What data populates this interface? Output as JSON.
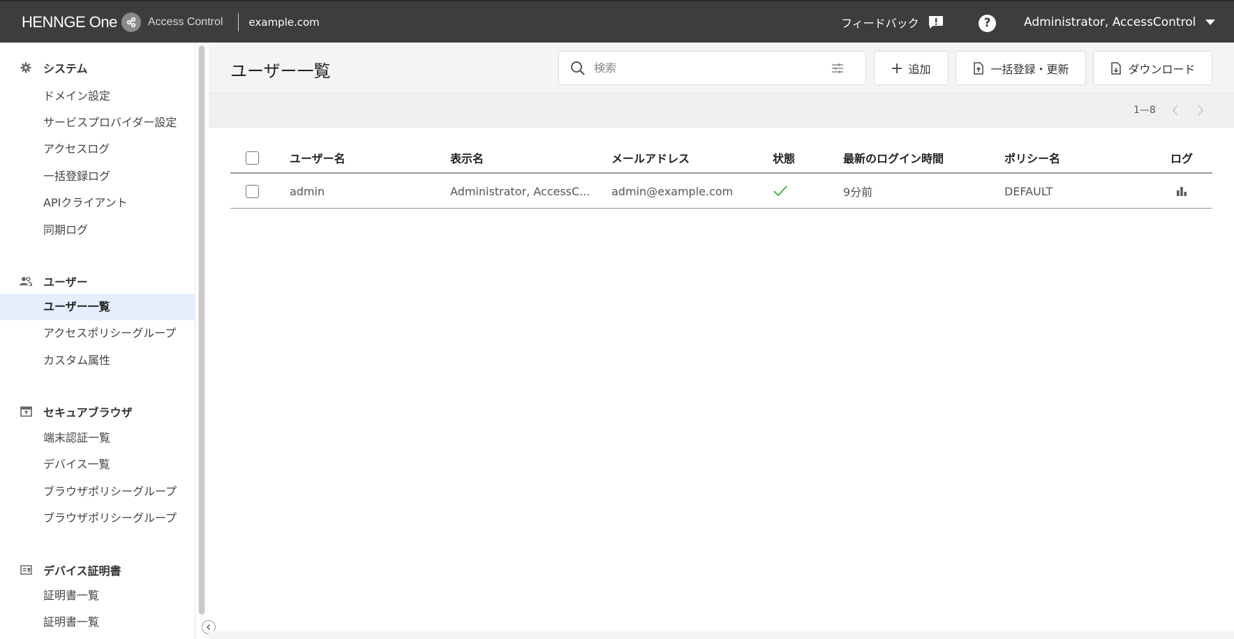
{
  "topbar": {
    "brand_name": "HENNGE One",
    "product_name": "Access Control",
    "domain": "example.com",
    "feedback_label": "フィードバック",
    "help_label": "?",
    "user_name": "Administrator, AccessControl"
  },
  "sidebar": {
    "sections": [
      {
        "title": "システム",
        "icon": "gear-icon",
        "items": [
          "ドメイン設定",
          "サービスプロバイダー設定",
          "アクセスログ",
          "一括登録ログ",
          "APIクライアント",
          "同期ログ"
        ]
      },
      {
        "title": "ユーザー",
        "icon": "users-icon",
        "items": [
          "ユーザー一覧",
          "アクセスポリシーグループ",
          "カスタム属性"
        ]
      },
      {
        "title": "セキュアブラウザ",
        "icon": "secure-browser-icon",
        "items": [
          "端末認証一覧",
          "デバイス一覧",
          "ブラウザポリシーグループ",
          "ブラウザポリシーグループ"
        ]
      },
      {
        "title": "デバイス証明書",
        "icon": "certificate-icon",
        "items": [
          "証明書一覧",
          "証明書一覧"
        ]
      }
    ],
    "active_item": "ユーザー一覧"
  },
  "main": {
    "page_title": "ユーザー一覧",
    "search_placeholder": "検索",
    "add_button": "追加",
    "bulk_button": "一括登録・更新",
    "download_button": "ダウンロード",
    "pagination": "1—8"
  },
  "table": {
    "columns": [
      "ユーザー名",
      "表示名",
      "メールアドレス",
      "状態",
      "最新のログイン時間",
      "ポリシー名",
      "ログ"
    ],
    "rows": [
      {
        "username": "admin",
        "display_name": "Administrator, AccessC...",
        "email": "admin@example.com",
        "status": "active",
        "last_login": "9分前",
        "policy": "DEFAULT"
      }
    ]
  },
  "colors": {
    "topbar_bg": "#3d3d3d",
    "active_bg": "#e4eefc",
    "status_ok": "#4caf50"
  }
}
